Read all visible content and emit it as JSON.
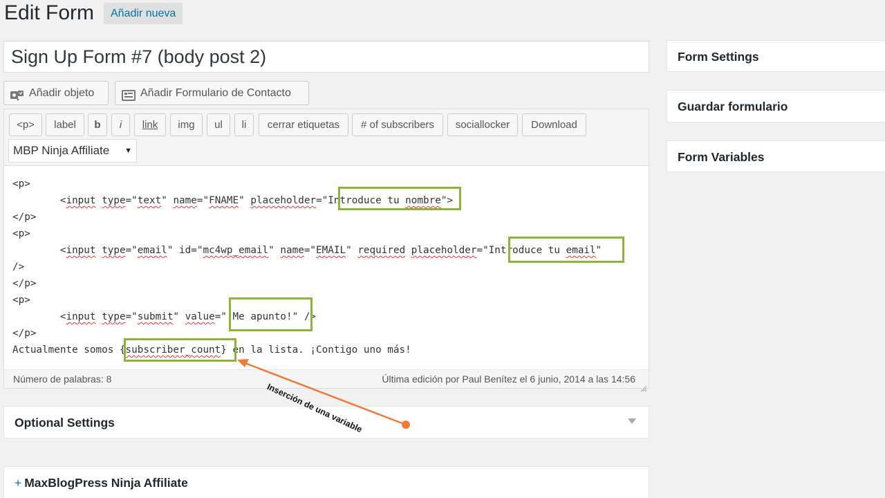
{
  "header": {
    "title": "Edit Form",
    "add_new": "Añadir nueva"
  },
  "form_title": "Sign Up Form #7 (body post 2)",
  "media_buttons": {
    "add_object": "Añadir objeto",
    "add_contact_form": "Añadir Formulario de Contacto"
  },
  "toolbar": {
    "buttons": [
      "<p>",
      "label",
      "b",
      "i",
      "link",
      "img",
      "ul",
      "li",
      "cerrar etiquetas",
      "# of subscribers",
      "sociallocker",
      "Download"
    ],
    "select_value": "MBP Ninja Affiliate"
  },
  "code": {
    "l1": "<p>",
    "l2_a": "        <",
    "l2_input": "input",
    "l2_b": " ",
    "l2_type": "type",
    "l2_c": "=\"",
    "l2_text": "text",
    "l2_d": "\" ",
    "l2_name": "name",
    "l2_e": "=\"",
    "l2_fname": "FNAME",
    "l2_f": "\" ",
    "l2_placeholder": "placeholder",
    "l2_g": "=\"",
    "l2_ph_a": "Introduce tu ",
    "l2_ph_b": "nombre",
    "l2_h": "\">",
    "l3": "</p>",
    "l4": "<p>",
    "l5_a": "        <",
    "l5_input": "input",
    "l5_b": " ",
    "l5_type": "type",
    "l5_c": "=\"",
    "l5_email": "email",
    "l5_d": "\" id=\"",
    "l5_id": "mc4wp_email",
    "l5_e": "\" ",
    "l5_name": "name",
    "l5_f": "=\"",
    "l5_EMAIL": "EMAIL",
    "l5_g": "\" ",
    "l5_required": "required",
    "l5_h": " ",
    "l5_placeholder": "placeholder",
    "l5_i": "=\"",
    "l5_ph_a": "Introduce tu ",
    "l5_ph_b": "email",
    "l5_j": "\"",
    "l6": "/>",
    "l7": "</p>",
    "l8": "<p>",
    "l9_a": "        <",
    "l9_input": "input",
    "l9_b": " ",
    "l9_type": "type",
    "l9_c": "=\"",
    "l9_submit": "submit",
    "l9_d": "\" ",
    "l9_value": "value",
    "l9_e": "=\"¡Me apunto!\" />",
    "l10": "</p>",
    "l11_a": "Actualmente somos {",
    "l11_var": "subscriber_count",
    "l11_b": "} en la lista. ¡Contigo uno más!"
  },
  "status": {
    "word_count": "Número de palabras: 8",
    "last_edit": "Última edición por Paul Benítez el 6 junio, 2014 a las 14:56"
  },
  "annotation": {
    "text": "Inserción de una variable",
    "color": "#f07a3a",
    "highlight_color": "#8cb43c"
  },
  "boxes": {
    "optional": "Optional Settings",
    "ninja": "MaxBlogPress Ninja Affiliate",
    "form_settings": "Form Settings",
    "save_form": "Guardar formulario",
    "form_variables": "Form Variables"
  },
  "colors": {
    "link": "#0073aa",
    "background": "#f1f1f1"
  }
}
